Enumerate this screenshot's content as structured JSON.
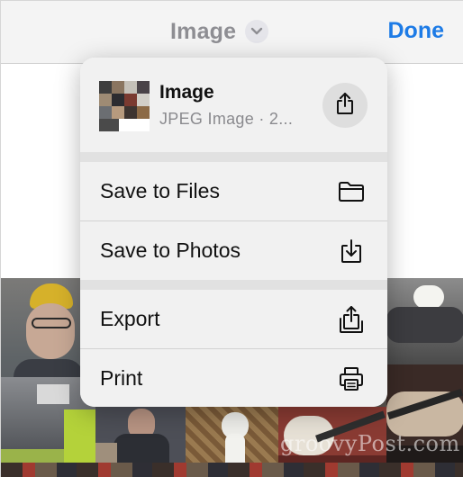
{
  "navbar": {
    "title": "Image",
    "done_label": "Done",
    "title_color": "#8e8e93",
    "done_color": "#1d7be6"
  },
  "share_menu": {
    "header": {
      "title": "Image",
      "subtitle": "JPEG Image · 2..."
    },
    "items": [
      {
        "label": "Save to Files",
        "icon": "folder-icon"
      },
      {
        "label": "Save to Photos",
        "icon": "save-to-photos-icon"
      },
      {
        "label": "Export",
        "icon": "export-icon"
      },
      {
        "label": "Print",
        "icon": "printer-icon"
      }
    ]
  },
  "watermark": "groovyPost.com"
}
